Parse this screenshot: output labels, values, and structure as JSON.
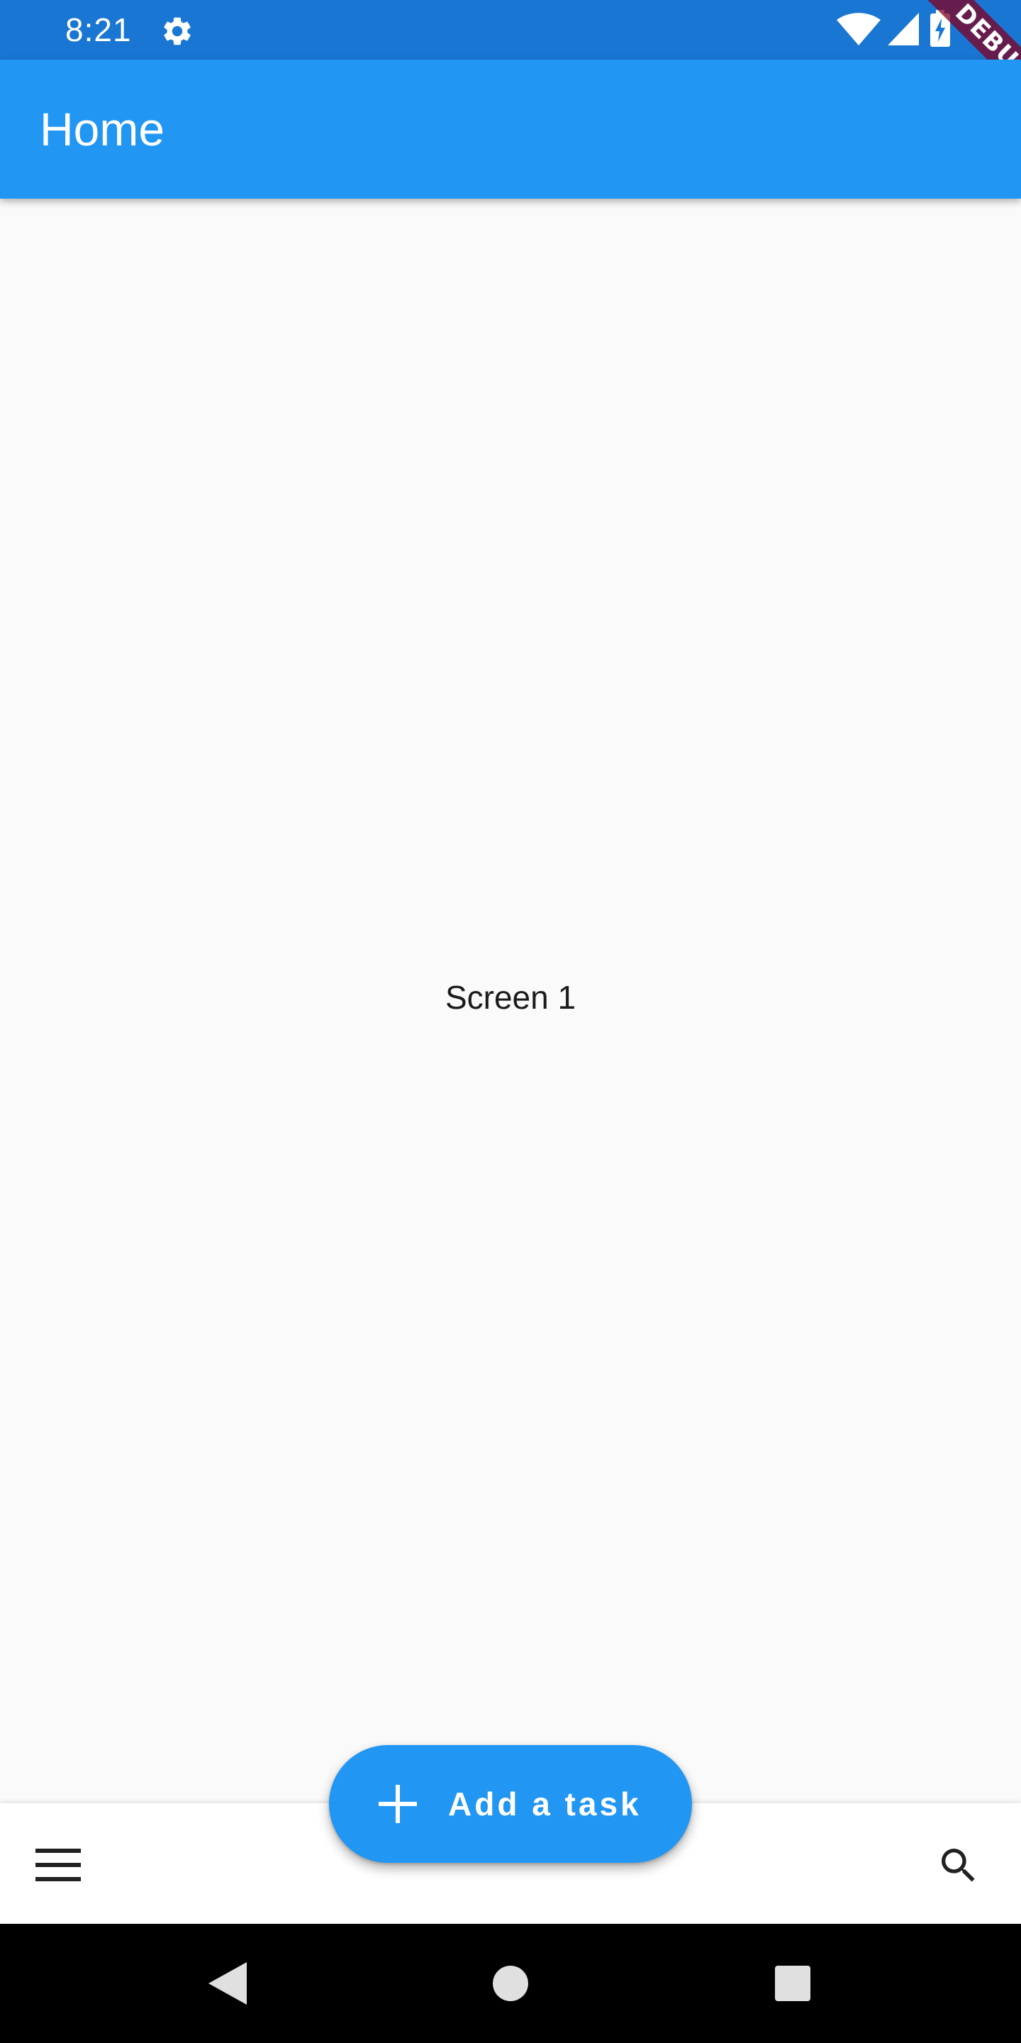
{
  "status_bar": {
    "time": "8:21",
    "icons": [
      "gear-icon",
      "wifi-icon",
      "cell-signal-icon",
      "battery-charging-icon"
    ],
    "background": "#1976d2"
  },
  "debug_banner": {
    "label": "DEBUG"
  },
  "app_bar": {
    "title": "Home",
    "background": "#2196f3"
  },
  "body": {
    "text": "Screen 1"
  },
  "fab": {
    "label": "Add a task",
    "icon": "plus-icon",
    "background": "#2196f3"
  },
  "bottom_bar": {
    "left_icon": "menu-icon",
    "right_icon": "search-icon"
  },
  "nav_bar": {
    "icons": [
      "back-icon",
      "home-icon",
      "recents-icon"
    ]
  }
}
